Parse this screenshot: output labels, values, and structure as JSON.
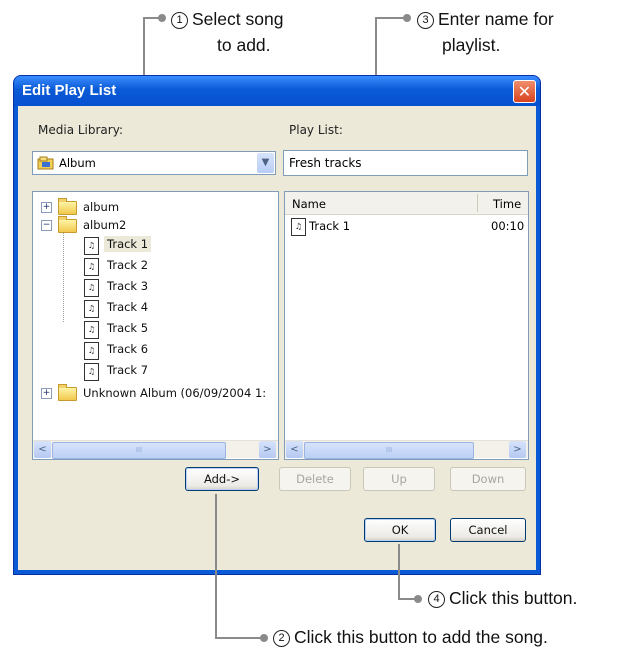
{
  "callouts": {
    "c1": {
      "num": "1",
      "line1": "Select song",
      "line2": "to add."
    },
    "c2": {
      "num": "2",
      "text": "Click this button to add the song."
    },
    "c3": {
      "num": "3",
      "line1": "Enter name for",
      "line2": "playlist."
    },
    "c4": {
      "num": "4",
      "text": "Click this button."
    }
  },
  "window": {
    "title": "Edit Play List",
    "close_glyph": "✕"
  },
  "library": {
    "label": "Media Library:",
    "source_value": "Album",
    "tree": [
      {
        "label": "album",
        "expander": "+",
        "type": "folder"
      },
      {
        "label": "album2",
        "expander": "−",
        "type": "folder"
      },
      {
        "label": "Track 1",
        "type": "track",
        "selected": true
      },
      {
        "label": "Track 2",
        "type": "track"
      },
      {
        "label": "Track 3",
        "type": "track"
      },
      {
        "label": "Track 4",
        "type": "track"
      },
      {
        "label": "Track 5",
        "type": "track"
      },
      {
        "label": "Track 6",
        "type": "track"
      },
      {
        "label": "Track 7",
        "type": "track"
      },
      {
        "label": "Unknown Album (06/09/2004 1:",
        "expander": "+",
        "type": "folder"
      }
    ]
  },
  "playlist": {
    "label": "Play List:",
    "name_value": "Fresh tracks",
    "columns": [
      "Name",
      "Time"
    ],
    "rows": [
      {
        "name": "Track 1",
        "time": "00:10"
      }
    ]
  },
  "buttons": {
    "add": "Add->",
    "delete": "Delete",
    "up": "Up",
    "down": "Down",
    "ok": "OK",
    "cancel": "Cancel"
  },
  "scroll": {
    "left": "<",
    "right": ">",
    "thumb": "III"
  },
  "colors": {
    "accent": "#0a5ad6",
    "selection": "#ece9d8",
    "close": "#d8431f"
  }
}
